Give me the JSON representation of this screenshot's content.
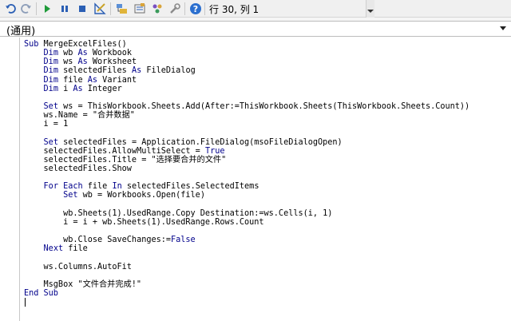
{
  "toolbar": {
    "status": "行 30, 列 1",
    "buttons": [
      {
        "name": "undo-icon"
      },
      {
        "name": "redo-icon"
      },
      {
        "name": "run-icon"
      },
      {
        "name": "pause-icon"
      },
      {
        "name": "stop-icon"
      },
      {
        "name": "design-mode-icon"
      },
      {
        "name": "project-explorer-icon"
      },
      {
        "name": "properties-icon"
      },
      {
        "name": "object-browser-icon"
      },
      {
        "name": "toolbox-icon"
      },
      {
        "name": "help-icon"
      }
    ]
  },
  "procedure_dropdown": {
    "selected": "(通用)"
  },
  "code_lines": [
    [
      {
        "t": "Sub",
        "k": true
      },
      {
        "t": " MergeExcelFiles()"
      }
    ],
    [
      {
        "t": "    "
      },
      {
        "t": "Dim",
        "k": true
      },
      {
        "t": " wb "
      },
      {
        "t": "As",
        "k": true
      },
      {
        "t": " Workbook"
      }
    ],
    [
      {
        "t": "    "
      },
      {
        "t": "Dim",
        "k": true
      },
      {
        "t": " ws "
      },
      {
        "t": "As",
        "k": true
      },
      {
        "t": " Worksheet"
      }
    ],
    [
      {
        "t": "    "
      },
      {
        "t": "Dim",
        "k": true
      },
      {
        "t": " selectedFiles "
      },
      {
        "t": "As",
        "k": true
      },
      {
        "t": " FileDialog"
      }
    ],
    [
      {
        "t": "    "
      },
      {
        "t": "Dim",
        "k": true
      },
      {
        "t": " file "
      },
      {
        "t": "As",
        "k": true
      },
      {
        "t": " Variant"
      }
    ],
    [
      {
        "t": "    "
      },
      {
        "t": "Dim",
        "k": true
      },
      {
        "t": " i "
      },
      {
        "t": "As",
        "k": true
      },
      {
        "t": " Integer"
      }
    ],
    [
      {
        "t": ""
      }
    ],
    [
      {
        "t": "    "
      },
      {
        "t": "Set",
        "k": true
      },
      {
        "t": " ws = ThisWorkbook.Sheets.Add(After:=ThisWorkbook.Sheets(ThisWorkbook.Sheets.Count))"
      }
    ],
    [
      {
        "t": "    ws.Name = \"合并数据\""
      }
    ],
    [
      {
        "t": "    i = 1"
      }
    ],
    [
      {
        "t": ""
      }
    ],
    [
      {
        "t": "    "
      },
      {
        "t": "Set",
        "k": true
      },
      {
        "t": " selectedFiles = Application.FileDialog(msoFileDialogOpen)"
      }
    ],
    [
      {
        "t": "    selectedFiles.AllowMultiSelect = "
      },
      {
        "t": "True",
        "k": true
      }
    ],
    [
      {
        "t": "    selectedFiles.Title = \"选择要合并的文件\""
      }
    ],
    [
      {
        "t": "    selectedFiles.Show"
      }
    ],
    [
      {
        "t": ""
      }
    ],
    [
      {
        "t": "    "
      },
      {
        "t": "For Each",
        "k": true
      },
      {
        "t": " file "
      },
      {
        "t": "In",
        "k": true
      },
      {
        "t": " selectedFiles.SelectedItems"
      }
    ],
    [
      {
        "t": "        "
      },
      {
        "t": "Set",
        "k": true
      },
      {
        "t": " wb = Workbooks.Open(file)"
      }
    ],
    [
      {
        "t": ""
      }
    ],
    [
      {
        "t": "        wb.Sheets(1).UsedRange.Copy Destination:=ws.Cells(i, 1)"
      }
    ],
    [
      {
        "t": "        i = i + wb.Sheets(1).UsedRange.Rows.Count"
      }
    ],
    [
      {
        "t": ""
      }
    ],
    [
      {
        "t": "        wb.Close SaveChanges:="
      },
      {
        "t": "False",
        "k": true
      }
    ],
    [
      {
        "t": "    "
      },
      {
        "t": "Next",
        "k": true
      },
      {
        "t": " file"
      }
    ],
    [
      {
        "t": ""
      }
    ],
    [
      {
        "t": "    ws.Columns.AutoFit"
      }
    ],
    [
      {
        "t": ""
      }
    ],
    [
      {
        "t": "    MsgBox \"文件合并完成!\""
      }
    ],
    [
      {
        "t": "End Sub",
        "k": true
      }
    ],
    [
      {
        "t": ""
      }
    ]
  ]
}
